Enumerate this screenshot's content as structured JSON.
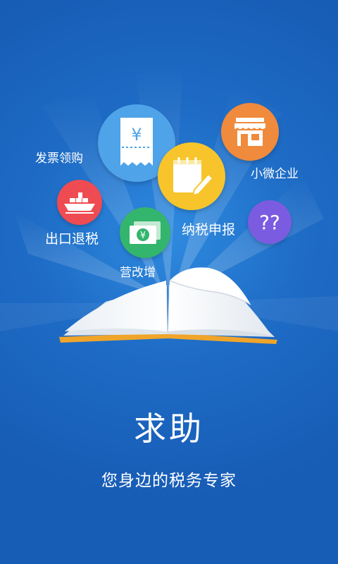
{
  "splash": {
    "title": "求助",
    "subtitle": "您身边的税务专家"
  },
  "topics": [
    {
      "label": "发票领购",
      "icon": "invoice-receipt-icon",
      "color": "#4fa3e8"
    },
    {
      "label": "小微企业",
      "icon": "storefront-icon",
      "color": "#f08a3c"
    },
    {
      "label": "出口退税",
      "icon": "cargo-ship-icon",
      "color": "#ef4b52"
    },
    {
      "label": "纳税申报",
      "icon": "notepad-pencil-icon",
      "color": "#f7c52b"
    },
    {
      "label": "营改增",
      "icon": "banknote-yuan-icon",
      "color": "#33b56d"
    },
    {
      "icon": "question-marks-icon",
      "color": "#7b5ce0"
    }
  ],
  "symbols": {
    "yuan": "¥",
    "question": "??"
  },
  "colors": {
    "background": "#1e6cc6",
    "book_cover": "#f0a52a",
    "text": "#ffffff"
  }
}
